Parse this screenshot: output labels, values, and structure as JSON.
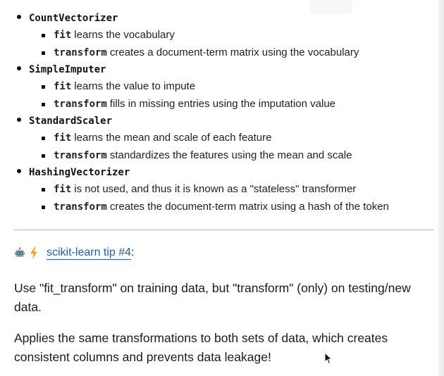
{
  "transformers": [
    {
      "name": "CountVectorizer",
      "items": [
        {
          "method": "fit",
          "text": "learns the vocabulary"
        },
        {
          "method": "transform",
          "text": "creates a document-term matrix using the vocabulary"
        }
      ]
    },
    {
      "name": "SimpleImputer",
      "items": [
        {
          "method": "fit",
          "text": "learns the value to impute"
        },
        {
          "method": "transform",
          "text": "fills in missing entries using the imputation value"
        }
      ]
    },
    {
      "name": "StandardScaler",
      "items": [
        {
          "method": "fit",
          "text": "learns the mean and scale of each feature"
        },
        {
          "method": "transform",
          "text": "standardizes the features using the mean and scale"
        }
      ]
    },
    {
      "name": "HashingVectorizer",
      "items": [
        {
          "method": "fit",
          "text": "is not used, and thus it is known as a \"stateless\" transformer"
        },
        {
          "method": "transform",
          "text": "creates the document-term matrix using a hash of the token"
        }
      ]
    }
  ],
  "tip": {
    "robot_icon": "robot-face-icon",
    "bolt_icon": "lightning-bolt-icon",
    "link_text": "scikit-learn tip #4",
    "suffix": ":"
  },
  "paragraphs": {
    "p1": "Use \"fit_transform\" on training data, but \"transform\" (only) on testing/new data.",
    "p2": "Applies the same transformations to both sets of data, which creates consistent columns and prevents data leakage!"
  },
  "colors": {
    "link": "#1f5fa8",
    "divider": "#b9b9b9",
    "bolt": "#f5a623"
  }
}
